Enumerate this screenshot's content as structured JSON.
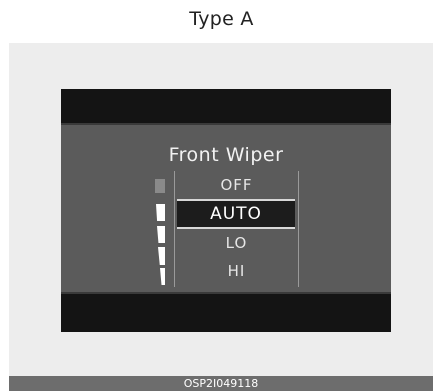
{
  "caption": "Type A",
  "display": {
    "title": "Front Wiper",
    "options": [
      "OFF",
      "AUTO",
      "LO",
      "HI"
    ],
    "selected_option": "AUTO",
    "level_indicator": {
      "total_segments": 5,
      "active_segments": 4
    }
  },
  "footer_code": "OSP2I049118",
  "colors": {
    "screen_bg": "#5b5b5b",
    "screen_bars": "#141414",
    "panel_bg": "#ededed",
    "footer_bg": "#6d6d6d",
    "text": "#ffffff"
  }
}
